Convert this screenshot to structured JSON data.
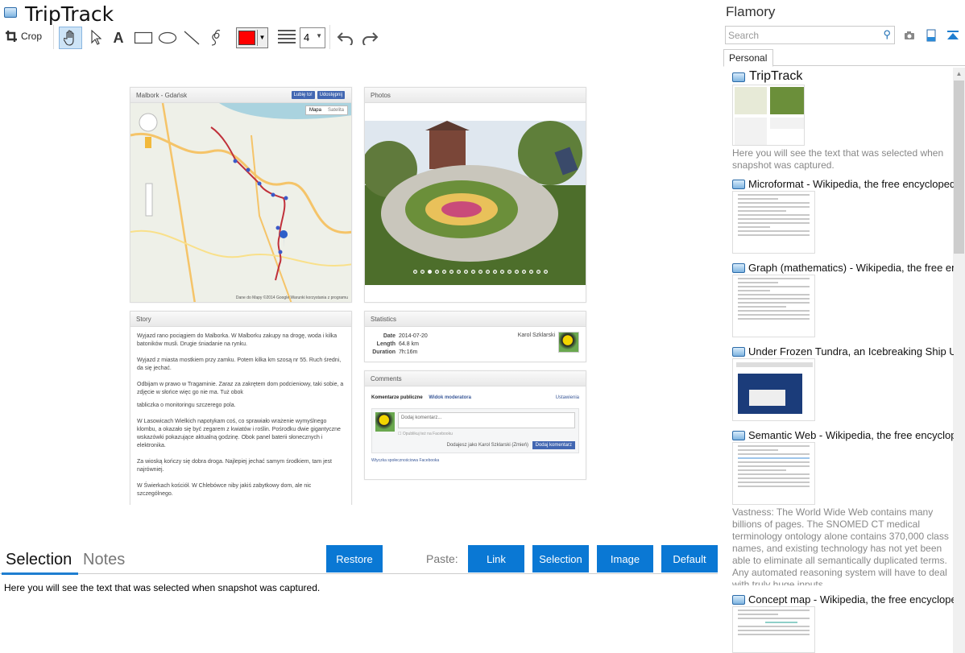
{
  "app": {
    "title": "TripTrack"
  },
  "toolbar": {
    "crop_label": "Crop",
    "line_width_value": "4"
  },
  "snapshot": {
    "map": {
      "header": "Malbork - Gdańsk",
      "fb_like": "Lubię to!",
      "fb_share": "Udostępnij",
      "btn_map": "Mapa",
      "btn_sat": "Satelita",
      "footer": "Dane do Mapy ©2014 Google   Warunki korzystania z programu"
    },
    "photos": {
      "header": "Photos"
    },
    "story": {
      "header": "Story",
      "paragraphs": [
        "Wyjazd rano pociągiem do Malborka. W Malborku zakupy na drogę, woda i kilka batoników musli. Drugie śniadanie na rynku.",
        "Wyjazd z miasta mostkiem przy zamku. Potem kilka km szosą nr 55. Ruch średni, da się jechać.",
        "Odbijam w prawo w Tragaminie. Zaraz za zakrętem dom podcieniowy, taki sobie, a zdjęcie w słońce więc go nie ma. Tuż obok",
        "tabliczka o monitoringu szczerego pola.",
        "W Lasowicach Wielkich napotykam coś, co sprawiało wrażenie wymyślnego klombu, a okazało się być zegarem z kwiatów i roślin. Pośrodku dwie gigantyczne wskazówki pokazujące aktualną godzinę. Obok panel baterii słonecznych i elektronika.",
        "Za wioską kończy się dobra droga. Najlepiej jechać samym środkiem, tam jest najrówniej.",
        "W Świerkach kościół. W Chlebówce niby jakiś zabytkowy dom, ale nic szczególnego."
      ]
    },
    "stats": {
      "header": "Statistics",
      "date_label": "Date",
      "date": "2014-07-20",
      "length_label": "Length",
      "length": "64.8 km",
      "duration_label": "Duration",
      "duration": "7h:16m",
      "author": "Karol Szklarski"
    },
    "comments": {
      "header": "Comments",
      "tab_public": "Komentarze publiczne",
      "tab_mod": "Widok moderatora",
      "settings": "Ustawienia",
      "placeholder": "Dodaj komentarz...",
      "post_fb": "Opublikuj też na Facebooku",
      "as_user": "Dodajesz jako Karol Szklarski (Zmień)",
      "submit": "Dodaj komentarz",
      "plugin": "Wtyczka społecznościowa Facebooka"
    }
  },
  "bottom": {
    "tab_selection": "Selection",
    "tab_notes": "Notes",
    "restore": "Restore",
    "paste_label": "Paste:",
    "paste_link": "Link",
    "paste_selection": "Selection",
    "paste_image": "Image",
    "paste_default": "Default",
    "selection_text": "Here you will see the text that was selected when snapshot was captured."
  },
  "sidebar": {
    "title": "Flamory",
    "search_placeholder": "Search",
    "tab_personal": "Personal",
    "items": [
      {
        "title": "TripTrack",
        "desc": "Here you will see the text that was selected when snapshot was captured."
      },
      {
        "title": "Microformat - Wikipedia, the free encyclopedia",
        "desc": ""
      },
      {
        "title": "Graph (mathematics) - Wikipedia, the free encyclopedia",
        "desc": ""
      },
      {
        "title": "Under Frozen Tundra, an Icebreaking Ship Uncovers...",
        "desc": ""
      },
      {
        "title": "Semantic Web - Wikipedia, the free encyclopedia",
        "desc": "Vastness: The World Wide Web contains many billions of pages. The SNOMED CT medical terminology ontology alone contains 370,000 class names, and existing technology has not yet been able to eliminate all semantically duplicated terms. Any automated reasoning system will have to deal with truly huge inputs."
      },
      {
        "title": "Concept map - Wikipedia, the free encyclopedia",
        "desc": ""
      }
    ]
  }
}
